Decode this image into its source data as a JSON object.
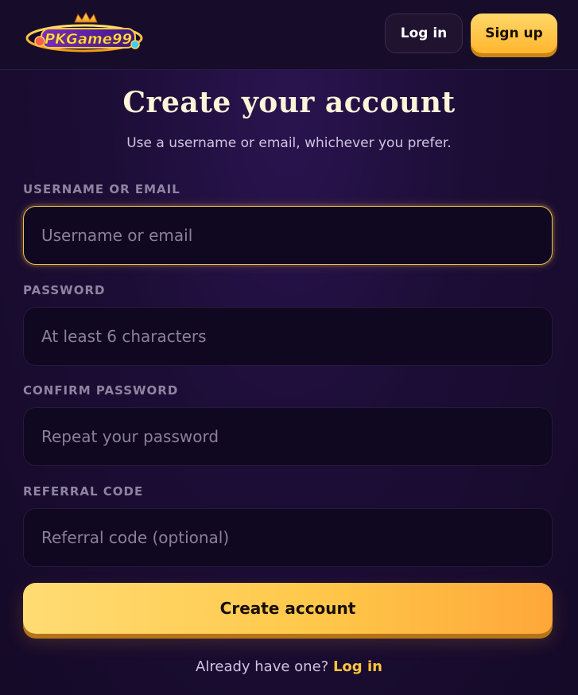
{
  "header": {
    "logo_text": "PKGame99",
    "login_label": "Log in",
    "signup_label": "Sign up"
  },
  "form": {
    "title": "Create your account",
    "subtitle": "Use a username or email, whichever you prefer.",
    "fields": [
      {
        "label": "USERNAME OR EMAIL",
        "placeholder": "Username or email",
        "value": ""
      },
      {
        "label": "PASSWORD",
        "placeholder": "At least 6 characters",
        "value": ""
      },
      {
        "label": "CONFIRM PASSWORD",
        "placeholder": "Repeat your password",
        "value": ""
      },
      {
        "label": "REFERRAL CODE",
        "placeholder": "Referral code (optional)",
        "value": ""
      }
    ],
    "submit_label": "Create account",
    "footer_prompt": "Already have one?",
    "footer_link": "Log in"
  },
  "colors": {
    "accent": "#ffc43d",
    "background": "#1c0d36",
    "input_bg": "#100820"
  }
}
